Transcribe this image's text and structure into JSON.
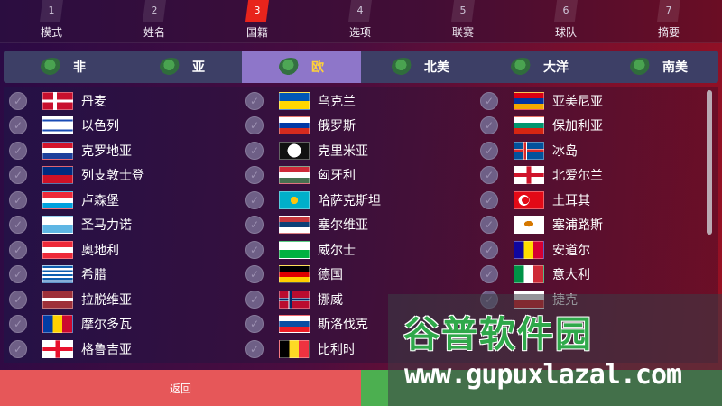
{
  "steps": [
    {
      "num": "1",
      "label": "模式"
    },
    {
      "num": "2",
      "label": "姓名"
    },
    {
      "num": "3",
      "label": "国籍"
    },
    {
      "num": "4",
      "label": "选项"
    },
    {
      "num": "5",
      "label": "联赛"
    },
    {
      "num": "6",
      "label": "球队"
    },
    {
      "num": "7",
      "label": "摘要"
    }
  ],
  "active_step": 3,
  "tabs": [
    {
      "label": "非",
      "icon": "africa-map-icon"
    },
    {
      "label": "亚",
      "icon": "asia-map-icon"
    },
    {
      "label": "欧",
      "icon": "europe-map-icon"
    },
    {
      "label": "北美",
      "icon": "north-america-map-icon"
    },
    {
      "label": "大洋",
      "icon": "oceania-map-icon"
    },
    {
      "label": "南美",
      "icon": "south-america-map-icon"
    }
  ],
  "active_tab": "欧",
  "columns": [
    [
      "丹麦",
      "以色列",
      "克罗地亚",
      "列支敦士登",
      "卢森堡",
      "圣马力诺",
      "奥地利",
      "希腊",
      "拉脱维亚",
      "摩尔多瓦",
      "格鲁吉亚"
    ],
    [
      "乌克兰",
      "俄罗斯",
      "克里米亚",
      "匈牙利",
      "哈萨克斯坦",
      "塞尔维亚",
      "威尔士",
      "德国",
      "挪威",
      "斯洛伐克",
      "比利时"
    ],
    [
      "亚美尼亚",
      "保加利亚",
      "冰岛",
      "北爱尔兰",
      "土耳其",
      "塞浦路斯",
      "安道尔",
      "意大利",
      "捷克"
    ]
  ],
  "footer": {
    "back_label": "返回"
  },
  "watermark": {
    "title": "谷普软件园",
    "url": "www.gupuxlazal.com"
  }
}
